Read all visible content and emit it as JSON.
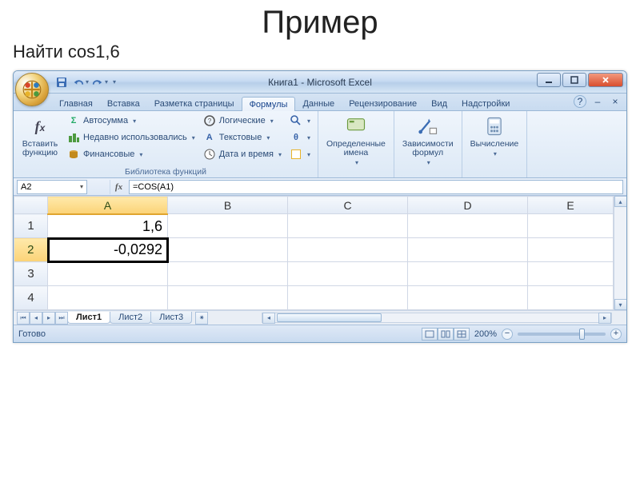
{
  "slide": {
    "title": "Пример",
    "subtitle": "Найти cos1,6"
  },
  "window": {
    "title": "Книга1 - Microsoft Excel",
    "qat": {
      "save": "save",
      "undo": "undo",
      "redo": "redo"
    }
  },
  "ribbon_tabs": {
    "items": [
      "Главная",
      "Вставка",
      "Разметка страницы",
      "Формулы",
      "Данные",
      "Рецензирование",
      "Вид",
      "Надстройки"
    ],
    "active_index": 3
  },
  "ribbon": {
    "group_library_label": "Библиотека функций",
    "insert_fn_label": "Вставить\nфункцию",
    "autosum": "Автосумма",
    "recent": "Недавно использовались",
    "financial": "Финансовые",
    "logical": "Логические",
    "text": "Текстовые",
    "datetime": "Дата и время",
    "lookup_icon": "lookup",
    "math_icon": "math",
    "more_icon": "more",
    "defined_names_label": "Определенные\nимена",
    "formula_auditing_label": "Зависимости\nформул",
    "calculation_label": "Вычисление"
  },
  "formula_bar": {
    "name_box": "A2",
    "fx_label": "fx",
    "formula": "=COS(A1)"
  },
  "grid": {
    "columns": [
      "A",
      "B",
      "C",
      "D",
      "E"
    ],
    "active_col_index": 0,
    "rows": [
      {
        "n": "1",
        "cells": [
          "1,6",
          "",
          "",
          "",
          ""
        ]
      },
      {
        "n": "2",
        "cells": [
          "-0,0292",
          "",
          "",
          "",
          ""
        ]
      },
      {
        "n": "3",
        "cells": [
          "",
          "",
          "",
          "",
          ""
        ]
      },
      {
        "n": "4",
        "cells": [
          "",
          "",
          "",
          "",
          ""
        ]
      }
    ],
    "active_row_index": 1,
    "selected": {
      "r": 1,
      "c": 0
    }
  },
  "sheet_tabs": {
    "items": [
      "Лист1",
      "Лист2",
      "Лист3"
    ],
    "active_index": 0
  },
  "status": {
    "ready": "Готово",
    "zoom": "200%"
  }
}
